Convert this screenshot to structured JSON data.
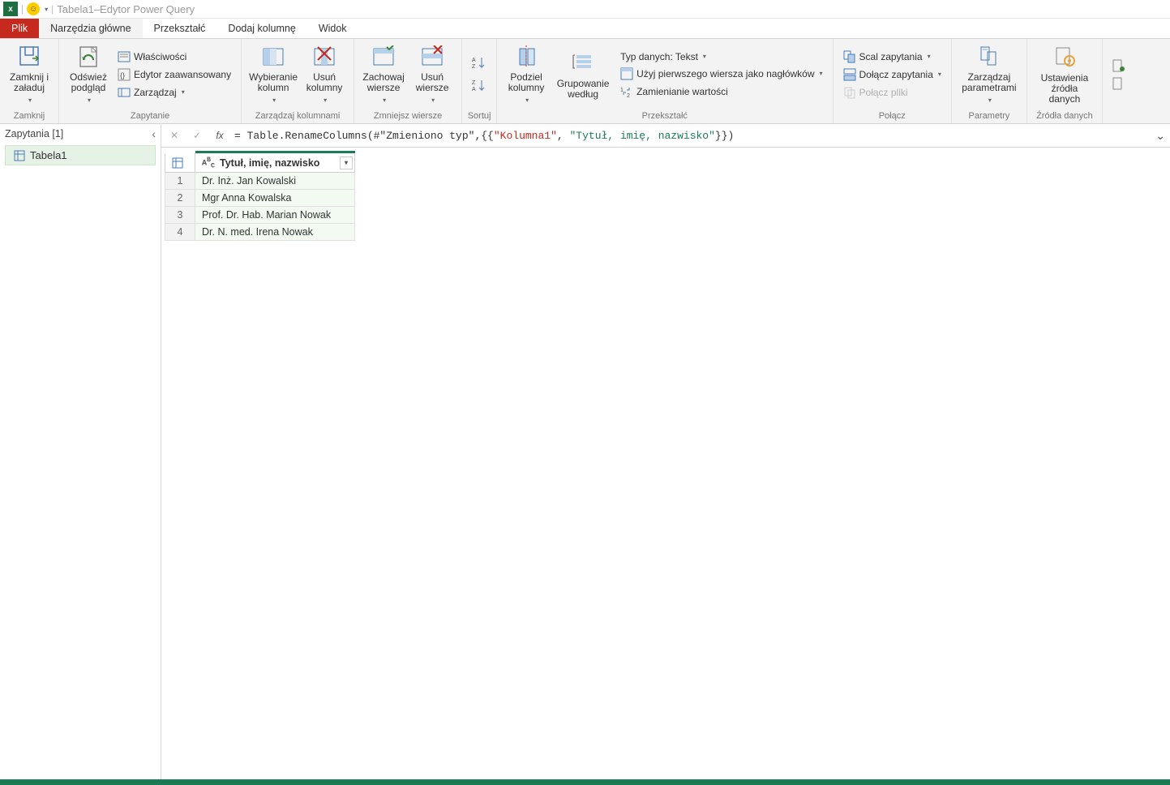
{
  "title": "Tabela1–Edytor Power Query",
  "tabs": {
    "file": "Plik",
    "list": [
      "Narzędzia główne",
      "Przekształć",
      "Dodaj kolumnę",
      "Widok"
    ]
  },
  "ribbon": {
    "close": {
      "apply": "Zamknij i\nzaładuj",
      "group": "Zamknij"
    },
    "query": {
      "refresh": "Odśwież\npodgląd",
      "properties": "Właściwości",
      "adv_editor": "Edytor zaawansowany",
      "manage": "Zarządzaj",
      "group": "Zapytanie"
    },
    "cols": {
      "choose": "Wybieranie\nkolumn",
      "remove": "Usuń\nkolumny",
      "group": "Zarządzaj kolumnami"
    },
    "rows": {
      "keep": "Zachowaj\nwiersze",
      "remove": "Usuń\nwiersze",
      "group": "Zmniejsz wiersze"
    },
    "sort": {
      "group": "Sortuj"
    },
    "transform": {
      "split": "Podziel\nkolumny",
      "groupby": "Grupowanie\nwedług",
      "datatype": "Typ danych: Tekst",
      "headers": "Użyj pierwszego wiersza jako nagłówków",
      "replace": "Zamienianie wartości",
      "group": "Przekształć"
    },
    "combine": {
      "merge": "Scal zapytania",
      "append": "Dołącz zapytania",
      "combine_files": "Połącz pliki",
      "group": "Połącz"
    },
    "params": {
      "manage": "Zarządzaj\nparametrami",
      "group": "Parametry"
    },
    "sources": {
      "settings": "Ustawienia\nźródła danych",
      "group": "Źródła danych"
    }
  },
  "sidebar": {
    "header": "Zapytania [1]",
    "items": [
      "Tabela1"
    ]
  },
  "formula": {
    "prefix": "= Table.RenameColumns(#\"Zmieniono typ\",{{",
    "str1": "\"Kolumna1\"",
    "mid": ", ",
    "str2": "\"Tytuł, imię, nazwisko\"",
    "suffix": "}})"
  },
  "preview": {
    "col_header": "Tytuł, imię, nazwisko",
    "rows": [
      "Dr. Inż. Jan Kowalski",
      "Mgr Anna Kowalska",
      "Prof. Dr. Hab. Marian Nowak",
      "Dr. N. med. Irena Nowak"
    ]
  }
}
